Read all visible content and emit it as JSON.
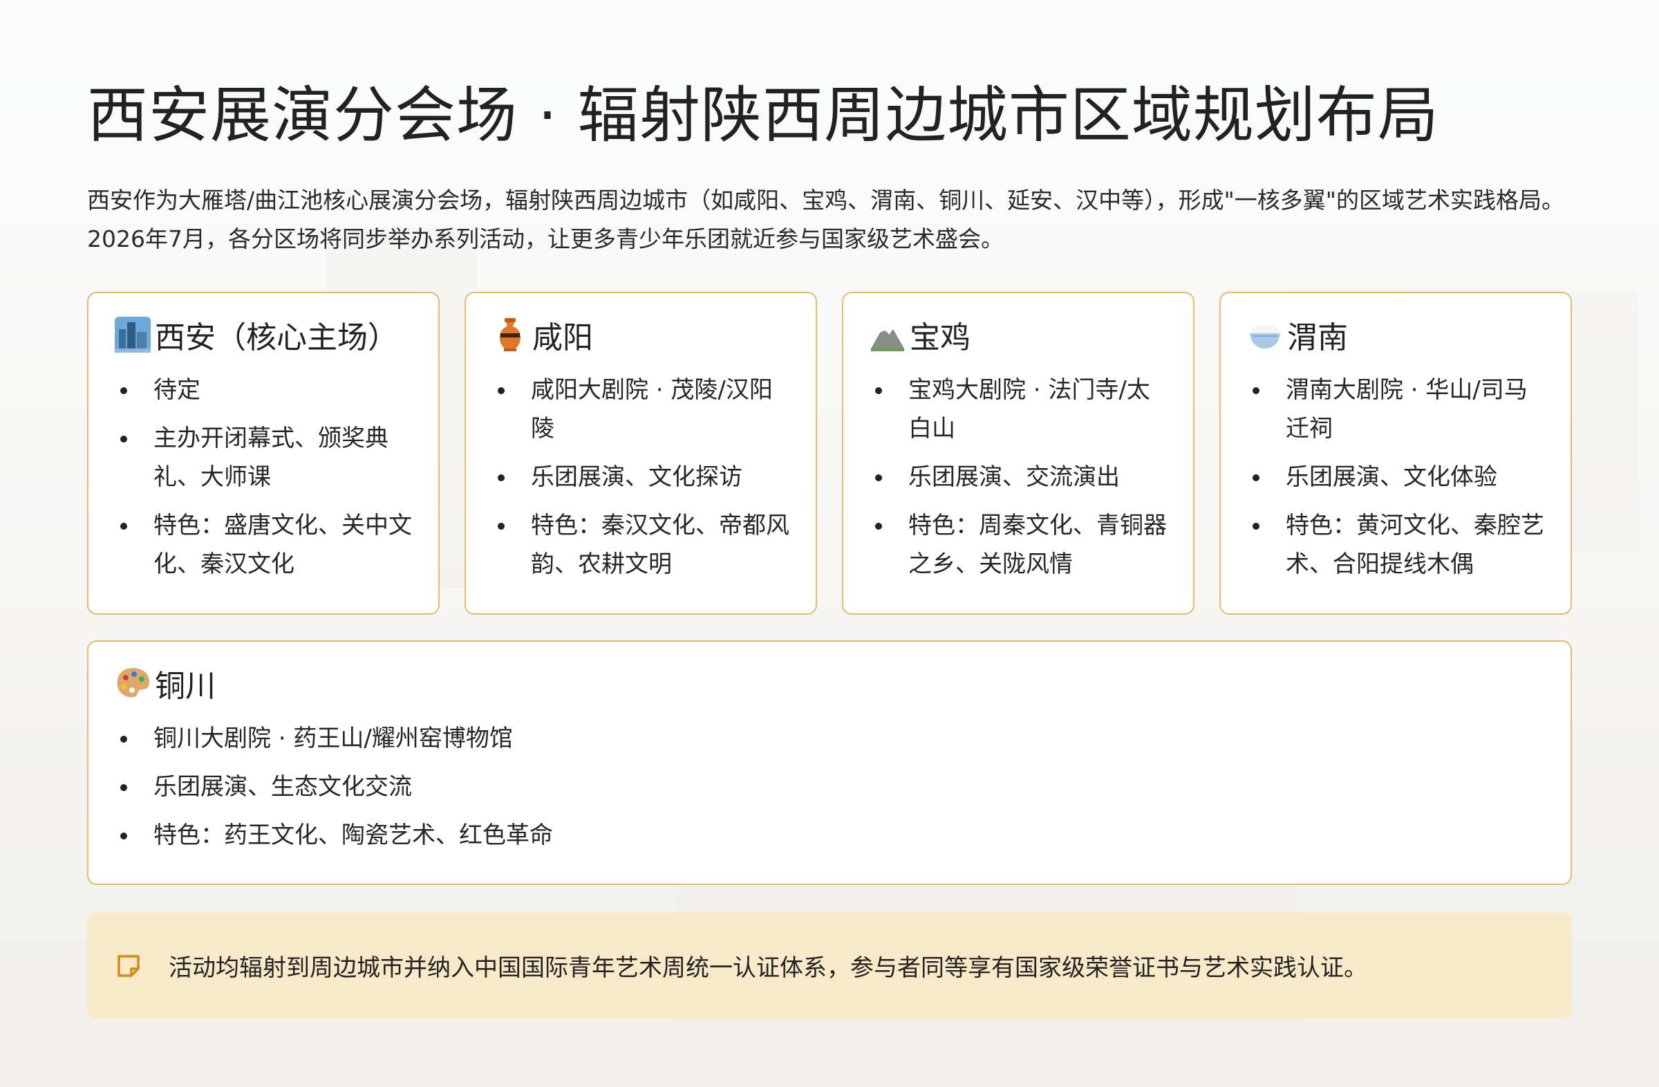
{
  "title": "西安展演分会场 · 辐射陕西周边城市区域规划布局",
  "intro": "西安作为大雁塔/曲江池核心展演分会场，辐射陕西周边城市（如咸阳、宝鸡、渭南、铜川、延安、汉中等），形成\"一核多翼\"的区域艺术实践格局。2026年7月，各分区场将同步举办系列活动，让更多青少年乐团就近参与国家级艺术盛会。",
  "colors": {
    "card_border": "#e9b970",
    "note_bg": "#f8e9c8"
  },
  "cards": [
    {
      "icon": "cityscape-icon",
      "name": "西安（核心主场）",
      "items": [
        "待定",
        "主办开闭幕式、颁奖典礼、大师课",
        "特色：盛唐文化、关中文化、秦汉文化"
      ]
    },
    {
      "icon": "amphora-icon",
      "name": "咸阳",
      "items": [
        "咸阳大剧院 · 茂陵/汉阳陵",
        "乐团展演、文化探访",
        "特色：秦汉文化、帝都风韵、农耕文明"
      ]
    },
    {
      "icon": "mountain-icon",
      "name": "宝鸡",
      "items": [
        "宝鸡大剧院 · 法门寺/太白山",
        "乐团展演、交流演出",
        "特色：周秦文化、青铜器之乡、关陇风情"
      ]
    },
    {
      "icon": "rice-bowl-icon",
      "name": "渭南",
      "items": [
        "渭南大剧院 · 华山/司马迁祠",
        "乐团展演、文化体验",
        "特色：黄河文化、秦腔艺术、合阳提线木偶"
      ]
    },
    {
      "icon": "palette-icon",
      "name": "铜川",
      "items": [
        "铜川大剧院 · 药王山/耀州窑博物馆",
        "乐团展演、生态文化交流",
        "特色：药王文化、陶瓷艺术、红色革命"
      ]
    }
  ],
  "note": {
    "icon": "memo-icon",
    "text": "活动均辐射到周边城市并纳入中国国际青年艺术周统一认证体系，参与者同等享有国家级荣誉证书与艺术实践认证。"
  }
}
